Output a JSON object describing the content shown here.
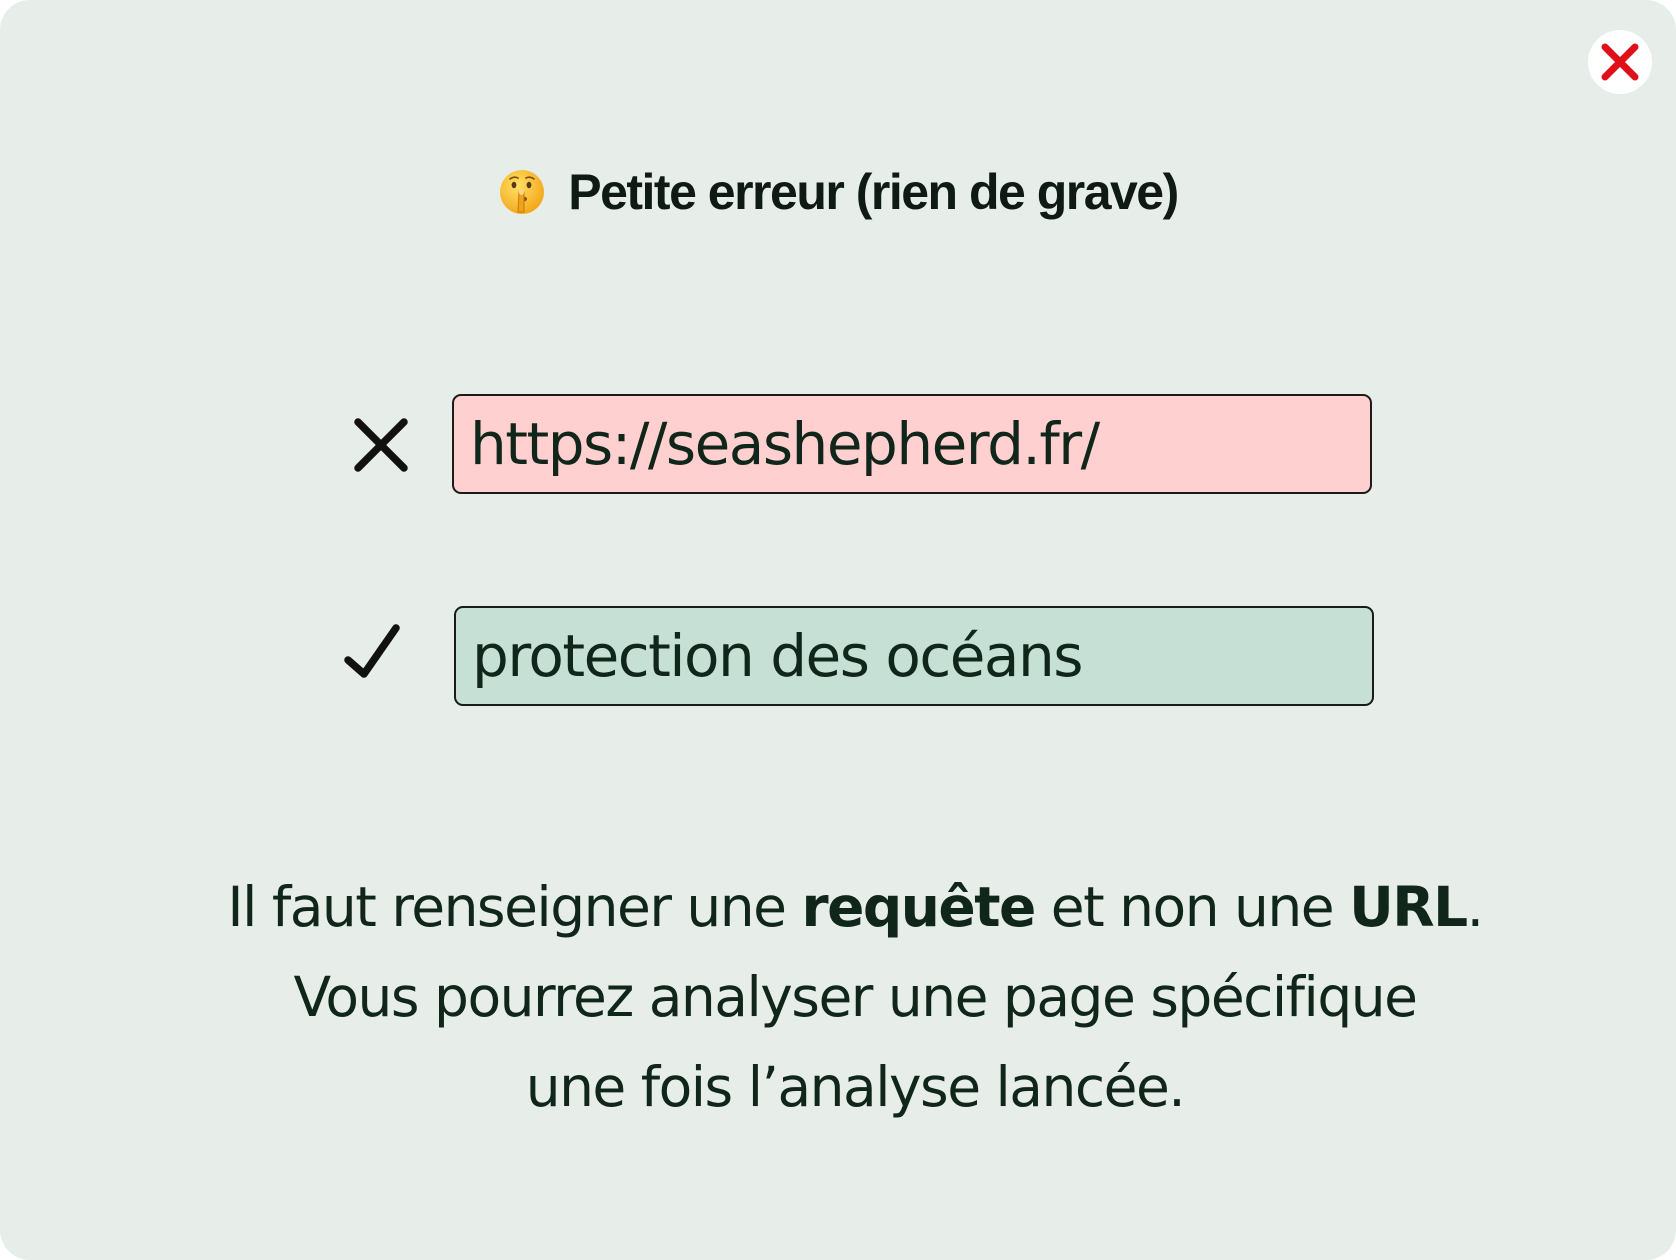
{
  "dialog": {
    "title": "Petite erreur (rien de grave)",
    "title_emoji": "shushing-face-icon",
    "close_icon": "close-icon",
    "accent_close_color": "#e0101a"
  },
  "examples": {
    "wrong": {
      "icon": "cross-icon",
      "value": "https://seashepherd.fr/",
      "background_color": "#ffd0cf"
    },
    "right": {
      "icon": "check-icon",
      "value": "protection des océans",
      "background_color": "#c6e0d5"
    }
  },
  "message": {
    "line1_part1": "Il faut renseigner une ",
    "line1_bold1": "requête",
    "line1_part2": " et non une ",
    "line1_bold2": "URL",
    "line1_part3": ".",
    "line2": "Vous pourrez analyser une page spécifique",
    "line3": "une fois l’analyse lancée."
  }
}
